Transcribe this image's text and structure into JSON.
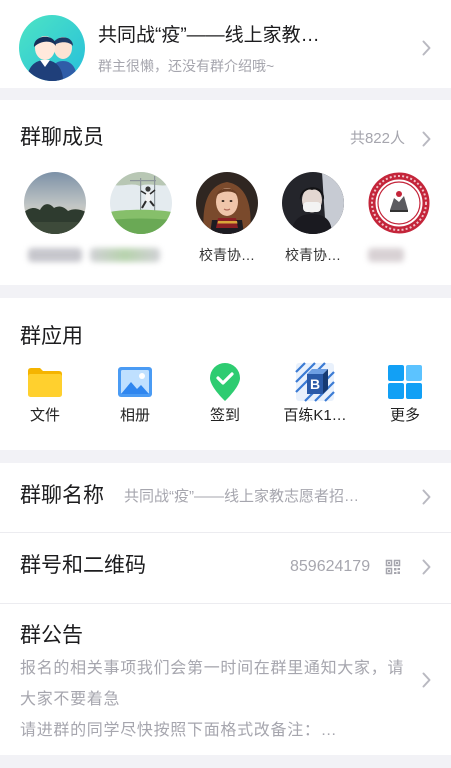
{
  "colors": {
    "page_background": "#f2f2f6",
    "card_background": "#ffffff",
    "primary_text": "#1c1c1e",
    "secondary_text": "#a6a6ae",
    "divider": "#ececf0",
    "chevron": "#b9b9c1"
  },
  "group_header": {
    "avatar_icon": "group-default-avatar",
    "title": "共同战“疫”——线上家教…",
    "subtitle": "群主很懒，还没有群介绍哦~"
  },
  "members": {
    "title": "群聊成员",
    "count_label": "共822人",
    "items": [
      {
        "avatar": "dusk-landscape-photo",
        "name": "",
        "name_blurred": true
      },
      {
        "avatar": "field-jump-photo",
        "name": "",
        "name_blurred": true
      },
      {
        "avatar": "girl-portrait-photo",
        "name": "校青协…",
        "name_blurred": false
      },
      {
        "avatar": "masked-person-photo",
        "name": "校青协…",
        "name_blurred": false
      },
      {
        "avatar": "university-seal-logo",
        "name": "",
        "name_blurred": true
      }
    ]
  },
  "apps": {
    "title": "群应用",
    "items": [
      {
        "label": "文件",
        "icon": "folder-icon",
        "color": "#ffd02e"
      },
      {
        "label": "相册",
        "icon": "photo-album-icon",
        "color": "#4a9bf4"
      },
      {
        "label": "签到",
        "icon": "check-in-pin-icon",
        "color": "#2ecc71"
      },
      {
        "label": "百练K1…",
        "icon": "bailian-app-icon",
        "logo_letter": "B",
        "color": "#2a5aa8"
      },
      {
        "label": "更多",
        "icon": "more-apps-icon",
        "color": "#12a0f5"
      }
    ]
  },
  "group_name": {
    "label": "群聊名称",
    "value": "共同战“疫”——线上家教志愿者招…"
  },
  "group_number": {
    "label": "群号和二维码",
    "value": "859624179",
    "qr_icon": "qr-code-icon"
  },
  "announcement": {
    "title": "群公告",
    "lines": [
      "报名的相关事项我们会第一时间在群里通知大家，请大家不要着急",
      "请进群的同学尽快按照下面格式改备注：…"
    ]
  }
}
